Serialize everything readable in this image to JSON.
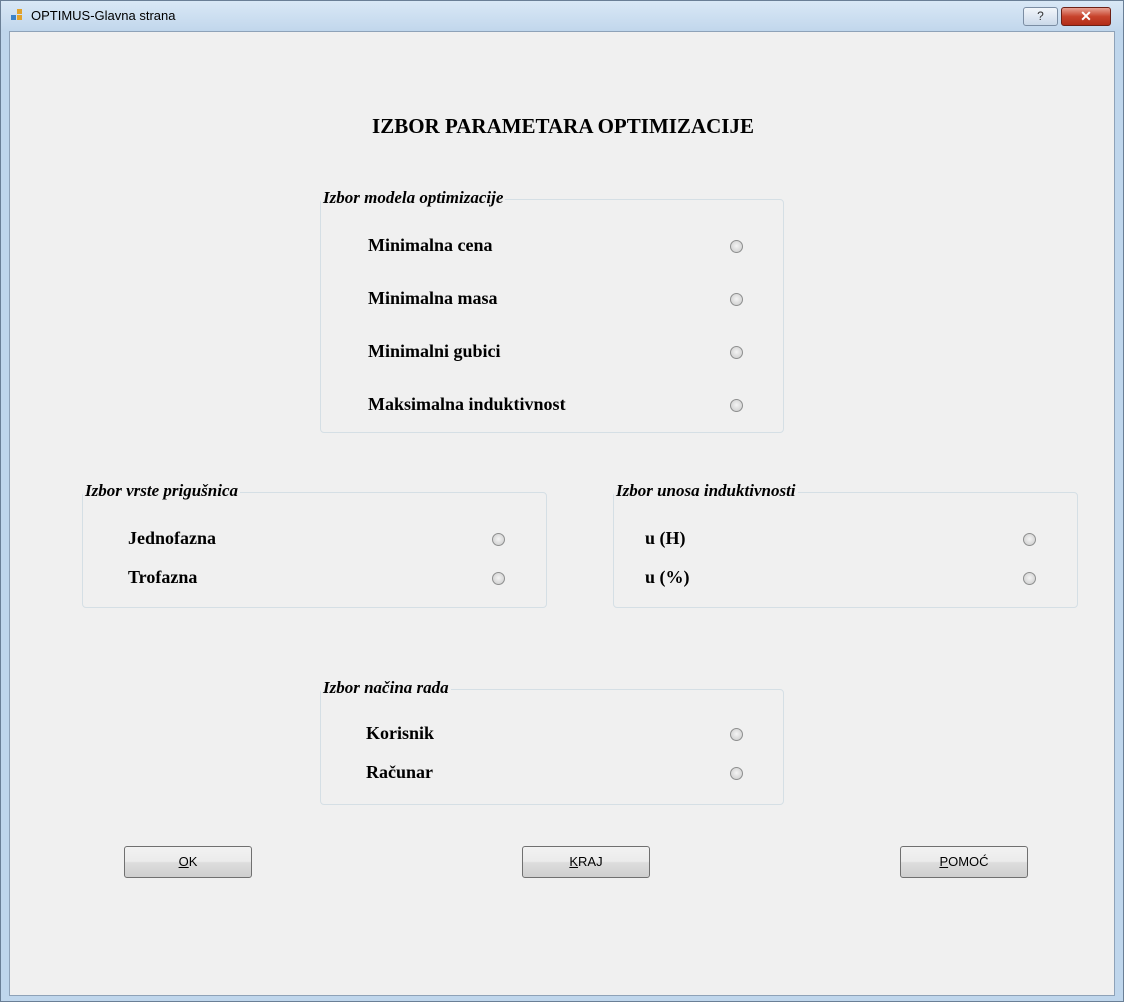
{
  "window": {
    "title": "OPTIMUS-Glavna strana",
    "help_label": "?",
    "close_label": "✕"
  },
  "heading": "IZBOR PARAMETARA OPTIMIZACIJE",
  "groups": {
    "model": {
      "legend": "Izbor modela optimizacije",
      "options": [
        "Minimalna cena",
        "Minimalna masa",
        "Minimalni gubici",
        "Maksimalna induktivnost"
      ]
    },
    "type": {
      "legend": "Izbor vrste prigušnica",
      "options": [
        "Jednofazna",
        "Trofazna"
      ]
    },
    "inductance": {
      "legend": "Izbor unosa induktivnosti",
      "options": [
        "u (H)",
        "u (%)"
      ]
    },
    "mode": {
      "legend": "Izbor načina rada",
      "options": [
        "Korisnik",
        "Računar"
      ]
    }
  },
  "buttons": {
    "ok": {
      "mnemonic": "O",
      "rest": "K"
    },
    "kraj": {
      "mnemonic": "K",
      "rest": "RAJ"
    },
    "pomoc": {
      "mnemonic": "P",
      "rest": "OMOĆ"
    }
  },
  "colors": {
    "title_bar": "#c2d7ec",
    "client_bg": "#f0f0f0",
    "close_button": "#c7432c"
  }
}
